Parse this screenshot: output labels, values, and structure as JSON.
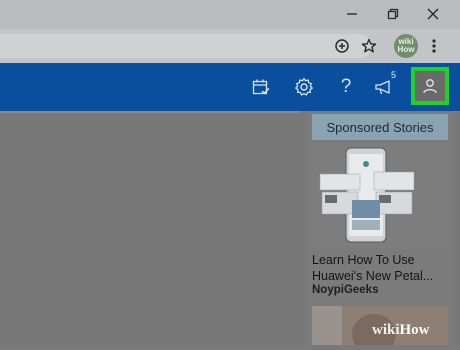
{
  "browser": {
    "window_controls": [
      "minimize",
      "restore",
      "close"
    ],
    "profile_avatar_text_line1": "wiki",
    "profile_avatar_text_line2": "How"
  },
  "toolbar": {
    "notification_count": "5",
    "icons": [
      "calendar-check-icon",
      "gear-icon",
      "help-icon",
      "megaphone-icon",
      "person-icon"
    ]
  },
  "sidebar": {
    "sponsored_heading": "Sponsored Stories",
    "story": {
      "title_line1": "Learn How To Use",
      "title_line2": "Huawei's New Petal...",
      "source": "NoypiGeeks"
    }
  },
  "watermark": {
    "part1": "wiki",
    "part2": "How"
  },
  "colors": {
    "app_bar": "#0a4e9e",
    "highlight": "#1fd12b",
    "sponsored_header": "#8aa3b3"
  }
}
